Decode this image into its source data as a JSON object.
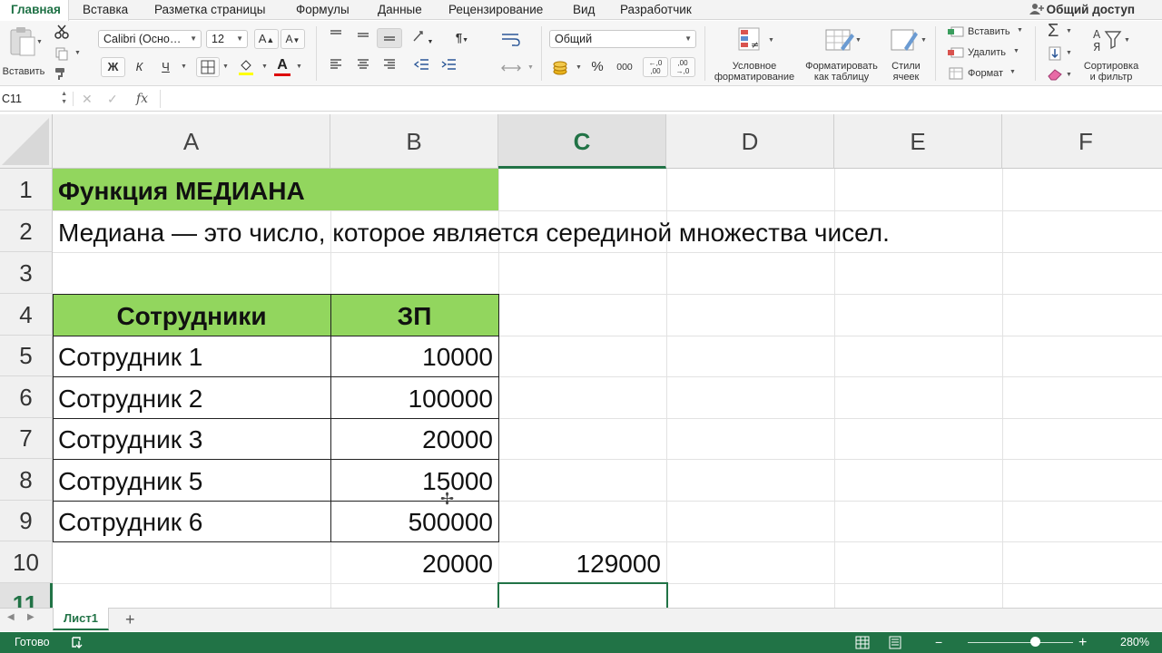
{
  "tabs": [
    "Главная",
    "Вставка",
    "Разметка страницы",
    "Формулы",
    "Данные",
    "Рецензирование",
    "Вид",
    "Разработчик"
  ],
  "share_label": "Общий доступ",
  "ribbon": {
    "paste_label": "Вставить",
    "font_name": "Calibri (Осно…",
    "font_size": "12",
    "grow_font": "A",
    "shrink_font": "A",
    "bold": "Ж",
    "italic": "К",
    "underline": "Ч",
    "font_color_glyph": "A",
    "number_format": "Общий",
    "percent": "%",
    "thousands": "000",
    "inc_decimal": "←,0 ,00",
    "dec_decimal": ",00 →,0",
    "cond_format": [
      "Условное",
      "форматирование"
    ],
    "format_table": [
      "Форматировать",
      "как таблицу"
    ],
    "cell_styles": [
      "Стили",
      "ячеек"
    ],
    "insert": "Вставить",
    "delete": "Удалить",
    "format": "Формат",
    "sort_filter": [
      "Сортировка",
      "и фильтр"
    ],
    "accent_color": "#217346"
  },
  "formula_bar": {
    "name_box": "C11",
    "cancel_glyph": "✕",
    "enter_glyph": "✓",
    "fx": "fx",
    "formula": ""
  },
  "columns": [
    "A",
    "B",
    "C",
    "D",
    "E",
    "F"
  ],
  "selected_column": "C",
  "rows": [
    "1",
    "2",
    "3",
    "4",
    "5",
    "6",
    "7",
    "8",
    "9",
    "10",
    "11"
  ],
  "selected_row": "11",
  "sheet": {
    "title": "Функция МЕДИАНА",
    "description": "Медиана — это число, которое является серединой множества чисел.",
    "table_headers": [
      "Сотрудники",
      "ЗП"
    ],
    "table_rows": [
      {
        "name": "Сотрудник 1",
        "salary": "10000"
      },
      {
        "name": "Сотрудник 2",
        "salary": "100000"
      },
      {
        "name": "Сотрудник 3",
        "salary": "20000"
      },
      {
        "name": "Сотрудник 5",
        "salary": "15000"
      },
      {
        "name": "Сотрудник 6",
        "salary": "500000"
      }
    ],
    "median_value": "20000",
    "average_value": "129000",
    "header_fill": "#92d65e"
  },
  "sheet_tabs": [
    "Лист1"
  ],
  "add_sheet": "+",
  "status": {
    "ready": "Готово",
    "zoom_minus": "−",
    "zoom_plus": "+",
    "zoom": "280%",
    "zoom_level_percent": 280
  }
}
